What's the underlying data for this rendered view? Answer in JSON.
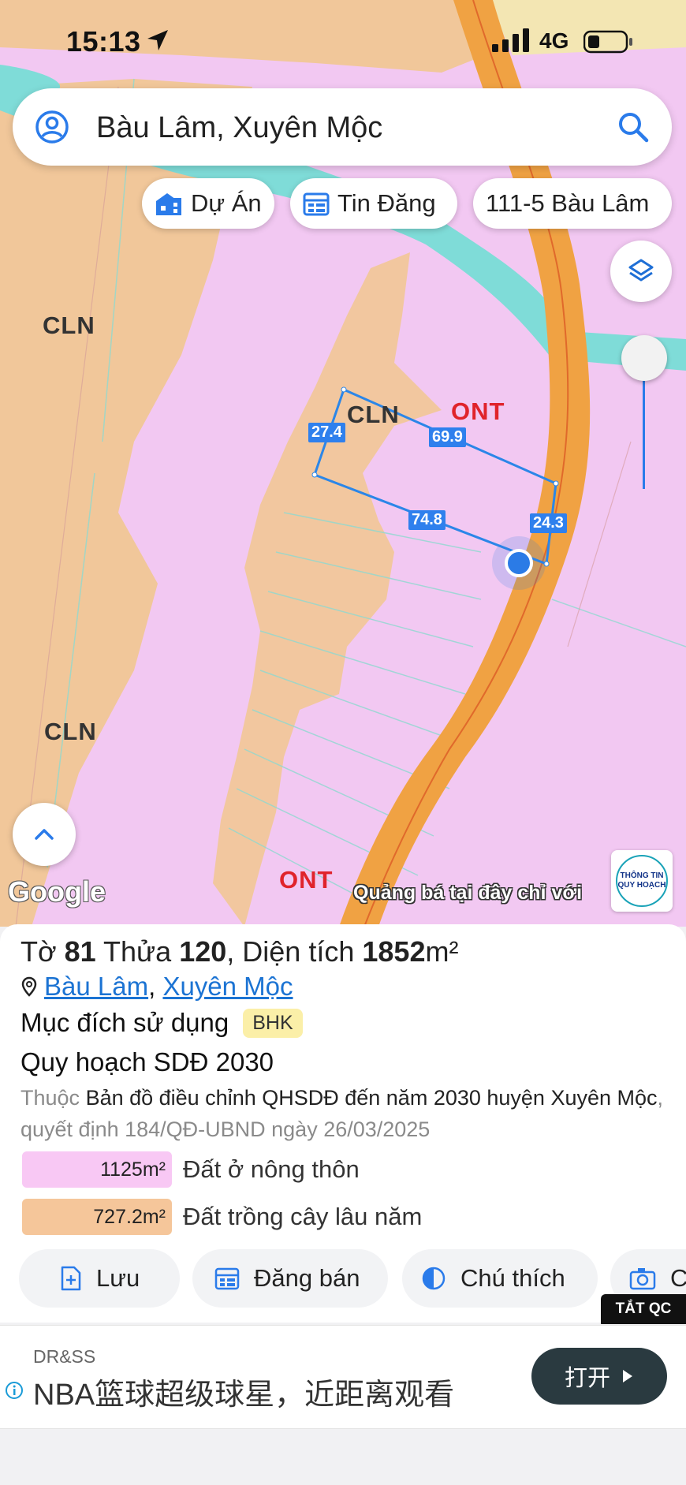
{
  "status_bar": {
    "time": "15:13",
    "network": "4G"
  },
  "search": {
    "value": "Bàu Lâm, Xuyên Mộc"
  },
  "chips": [
    {
      "label": "Dự Án",
      "icon": "building-icon"
    },
    {
      "label": "Tin Đăng",
      "icon": "listing-icon"
    },
    {
      "label": "111-5 Bàu Lâm"
    }
  ],
  "map": {
    "zones": {
      "cln_1": "CLN",
      "cln_2": "CLN",
      "cln_3": "CLN",
      "ont_1": "ONT",
      "ont_2": "ONT"
    },
    "measurements": {
      "left": "27.4",
      "top": "69.9",
      "bottom": "74.8",
      "right": "24.3"
    },
    "google_logo": "Google",
    "ad_banner": "Quảng bá tại đây chỉ với",
    "badge": {
      "line1": "THÔNG TIN",
      "line2": "QUY HOẠCH"
    },
    "colors": {
      "ont": "#f2c8f2",
      "cln": "#f1c79a",
      "road": "#f0a243",
      "river": "#7fdcd8",
      "parcel_line": "#2b86e8"
    }
  },
  "parcel": {
    "to_label": "Tờ",
    "to_value": "81",
    "thua_label": "Thửa",
    "thua_value": "120",
    "area_label": "Diện tích",
    "area_value": "1852",
    "area_unit": "m²",
    "address_commune": "Bàu Lâm",
    "address_sep": ",",
    "address_district": "Xuyên Mộc",
    "purpose_label": "Mục đích sử dụng",
    "purpose_code": "BHK",
    "plan_title": "Quy hoạch SDĐ 2030",
    "desc_prefix": "Thuộc",
    "desc_map": "Bản đồ điều chỉnh QHSDĐ đến năm 2030 huyện Xuyên Mộc",
    "desc_suffix": ", quyết định 184/QĐ-UBND ngày 26/03/2025",
    "areas": [
      {
        "value": "1125m²",
        "label": "Đất ở nông thôn",
        "color": "#f8c8f4"
      },
      {
        "value": "727.2m²",
        "label": "Đất trồng cây lâu năm",
        "color": "#f5c69a"
      }
    ]
  },
  "actions": [
    {
      "label": "Lưu",
      "icon": "save-icon"
    },
    {
      "label": "Đăng bán",
      "icon": "calendar-icon"
    },
    {
      "label": "Chú thích",
      "icon": "legend-icon"
    },
    {
      "label": "C",
      "icon": "camera-icon"
    }
  ],
  "tat_qc": "TẮT QC",
  "ad": {
    "sponsor": "DR&SS",
    "headline": "NBA篮球超级球星，近距离观看",
    "button": "打开"
  }
}
